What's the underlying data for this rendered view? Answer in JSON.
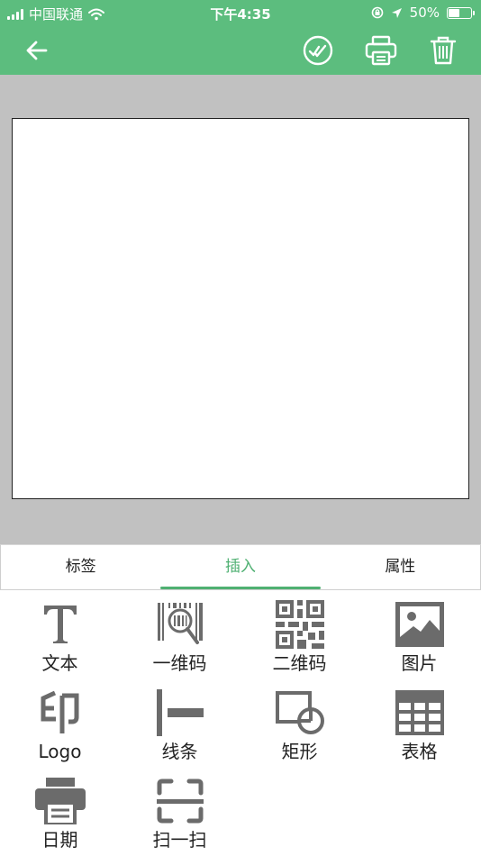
{
  "status_bar": {
    "carrier": "中国联通",
    "time": "下午4:35",
    "battery": "50%",
    "battery_level": 0.5
  },
  "nav": {
    "icons": [
      "back-arrow-icon",
      "check-circle-icon",
      "printer-icon",
      "trash-icon"
    ]
  },
  "tabs": [
    {
      "label": "标签"
    },
    {
      "label": "插入"
    },
    {
      "label": "属性"
    }
  ],
  "active_tab": 1,
  "tools": [
    {
      "label": "文本",
      "icon": "text-icon"
    },
    {
      "label": "一维码",
      "icon": "barcode-icon"
    },
    {
      "label": "二维码",
      "icon": "qrcode-icon"
    },
    {
      "label": "图片",
      "icon": "image-icon"
    },
    {
      "label": "Logo",
      "icon": "seal-icon"
    },
    {
      "label": "线条",
      "icon": "line-icon"
    },
    {
      "label": "矩形",
      "icon": "rectangle-icon"
    },
    {
      "label": "表格",
      "icon": "table-icon"
    },
    {
      "label": "日期",
      "icon": "printer-icon"
    },
    {
      "label": "扫一扫",
      "icon": "scan-icon"
    }
  ],
  "colors": {
    "brand": "#5cbd7e",
    "accent": "#4fb072",
    "icon_gray": "#6b6b6b",
    "workspace": "#c1c1c1"
  }
}
